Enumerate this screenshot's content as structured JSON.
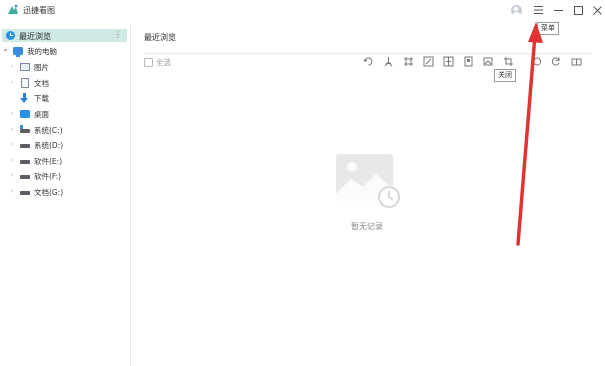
{
  "window": {
    "title": "迅捷看图",
    "controls": {
      "menu_tooltip": "菜单",
      "minimize_icon": "minimize-icon",
      "maximize_icon": "maximize-icon",
      "close_icon": "close-icon"
    }
  },
  "sidebar": {
    "recent": {
      "label": "最近浏览",
      "more": "⋮"
    },
    "tree": [
      {
        "label": "我的电脑",
        "icon": "computer-icon",
        "expanded": true
      },
      {
        "label": "图片",
        "icon": "pictures-folder-icon"
      },
      {
        "label": "文档",
        "icon": "documents-folder-icon"
      },
      {
        "label": "下载",
        "icon": "download-folder-icon"
      },
      {
        "label": "桌面",
        "icon": "desktop-folder-icon"
      },
      {
        "label": "系统(C:)",
        "icon": "system-drive-icon"
      },
      {
        "label": "系统(D:)",
        "icon": "drive-icon"
      },
      {
        "label": "软件(E:)",
        "icon": "drive-icon"
      },
      {
        "label": "软件(F:)",
        "icon": "drive-icon"
      },
      {
        "label": "文档(G:)",
        "icon": "drive-icon"
      }
    ]
  },
  "main": {
    "tab_title": "最近浏览",
    "select_all": "全选",
    "toolbar_tooltip": "关闭",
    "empty_text": "暂无记录"
  },
  "colors": {
    "accent": "#2b8fe6",
    "recent_highlight": "#cfe9e6",
    "annotation_arrow": "#e23232"
  }
}
